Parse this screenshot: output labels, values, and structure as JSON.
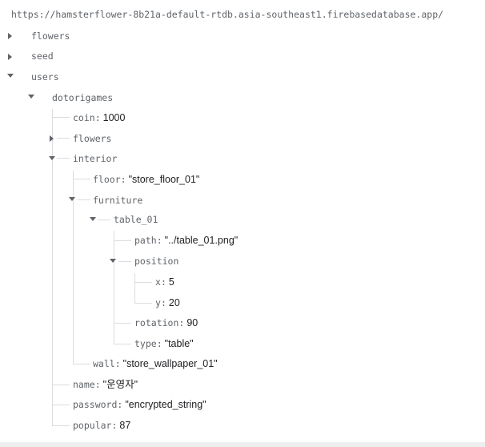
{
  "database_url": "https://hamsterflower-8b21a-default-rtdb.asia-southeast1.firebasedatabase.app/",
  "tree": {
    "flowers": "flowers",
    "seed": "seed",
    "users": "users",
    "dotorigames": "dotorigames",
    "coin": {
      "key": "coin",
      "value": "1000"
    },
    "user_flowers": "flowers",
    "interior": "interior",
    "floor": {
      "key": "floor",
      "value": "\"store_floor_01\""
    },
    "furniture": "furniture",
    "table_01": "table_01",
    "path": {
      "key": "path",
      "value": "\"../table_01.png\""
    },
    "position": "position",
    "x": {
      "key": "x",
      "value": "5"
    },
    "y": {
      "key": "y",
      "value": "20"
    },
    "rotation": {
      "key": "rotation",
      "value": "90"
    },
    "type": {
      "key": "type",
      "value": "\"table\""
    },
    "wall": {
      "key": "wall",
      "value": "\"store_wallpaper_01\""
    },
    "name": {
      "key": "name",
      "value": "\"운영자\""
    },
    "password": {
      "key": "password",
      "value": "\"encrypted_string\""
    },
    "popular": {
      "key": "popular",
      "value": "87"
    }
  },
  "separator": ":",
  "icons": {
    "collapsed": "expand-arrow-icon",
    "expanded": "collapse-arrow-icon"
  },
  "colors": {
    "key": "#5f6368",
    "value": "#202124",
    "guide": "#dadce0"
  }
}
